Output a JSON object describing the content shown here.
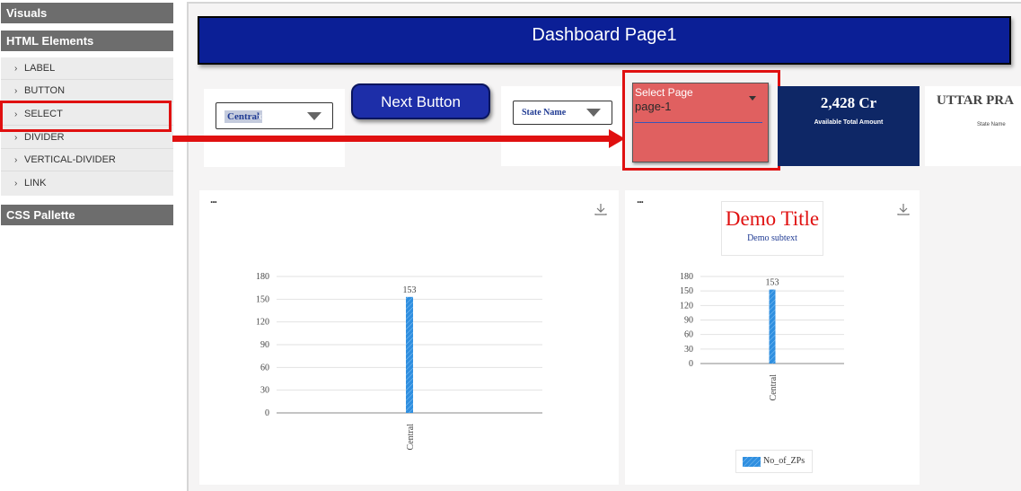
{
  "sidebar": {
    "sections": [
      "Visuals",
      "HTML Elements",
      "CSS Pallette"
    ],
    "items": [
      {
        "label": "LABEL"
      },
      {
        "label": "BUTTON"
      },
      {
        "label": "SELECT"
      },
      {
        "label": "DIVIDER"
      },
      {
        "label": "VERTICAL-DIVIDER"
      },
      {
        "label": "LINK"
      }
    ],
    "highlighted_item": "SELECT"
  },
  "header": {
    "title": "Dashboard Page1"
  },
  "filters": {
    "central_select": {
      "chip": "Central",
      "chip_remove": "x"
    },
    "state_select": {
      "value": "State Name"
    }
  },
  "next_button": {
    "label": "Next Button"
  },
  "page_select": {
    "label": "Select Page",
    "value": "page-1"
  },
  "kpi": {
    "value": "2,428 Cr",
    "caption": "Available Total Amount"
  },
  "state_card": {
    "title": "UTTAR PRA",
    "caption": "State Name"
  },
  "charts": [
    {
      "menu": "...",
      "title": "",
      "subtitle": ""
    },
    {
      "menu": "...",
      "title": "Demo Title",
      "subtitle": "Demo subtext",
      "legend": "No_of_ZPs"
    }
  ],
  "chart_data": [
    {
      "type": "bar",
      "categories": [
        "Central"
      ],
      "values": [
        153
      ],
      "data_labels": [
        "153"
      ],
      "yticks": [
        0,
        30,
        60,
        90,
        120,
        150,
        180
      ],
      "ylim": [
        0,
        180
      ],
      "grid": true
    },
    {
      "type": "bar",
      "categories": [
        "Central"
      ],
      "series": [
        {
          "name": "No_of_ZPs",
          "values": [
            153
          ]
        }
      ],
      "data_labels": [
        "153"
      ],
      "yticks": [
        0,
        30,
        60,
        90,
        120,
        150,
        180
      ],
      "ylim": [
        0,
        180
      ],
      "title": "Demo Title",
      "subtitle": "Demo subtext",
      "legend": "bottom",
      "grid": true
    }
  ],
  "colors": {
    "header_bg": "#0b1f96",
    "button_bg": "#1d2ea8",
    "page_select_bg": "#e06060",
    "kpi_bg": "#0e2766",
    "bar": "#2f8fe0",
    "highlight": "#e01010",
    "title_red": "#e01010"
  }
}
